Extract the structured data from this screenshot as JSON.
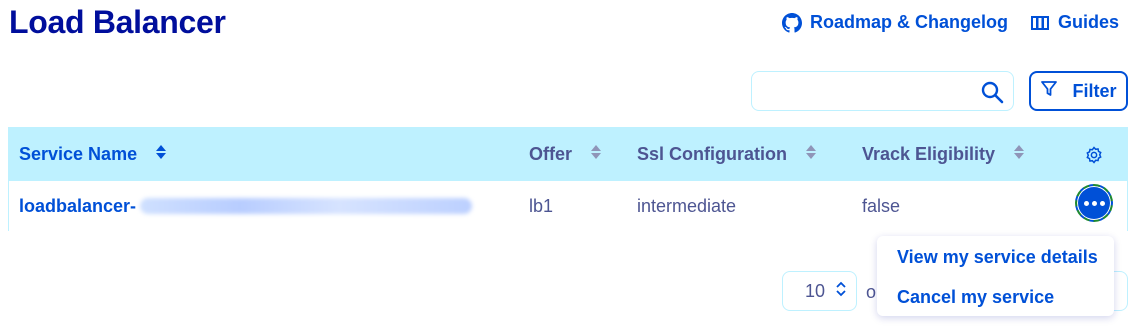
{
  "page": {
    "title": "Load Balancer"
  },
  "header": {
    "roadmap_label": "Roadmap & Changelog",
    "roadmap_icon": "github-icon",
    "guides_label": "Guides",
    "guides_icon": "book-icon"
  },
  "toolbar": {
    "search_value": "",
    "search_icon": "search-icon",
    "filter_label": "Filter",
    "filter_icon": "filter-icon"
  },
  "table": {
    "columns": [
      {
        "label": "Service Name",
        "sortable": true
      },
      {
        "label": "Offer",
        "sortable": true
      },
      {
        "label": "Ssl Configuration",
        "sortable": true
      },
      {
        "label": "Vrack Eligibility",
        "sortable": true
      }
    ],
    "settings_icon": "gear-icon",
    "rows": [
      {
        "service_name": "loadbalancer-",
        "offer": "lb1",
        "ssl_configuration": "intermediate",
        "vrack_eligibility": "false"
      }
    ]
  },
  "action_menu": {
    "items": [
      {
        "label": "View my service details"
      },
      {
        "label": "Cancel my service"
      }
    ]
  },
  "pagination": {
    "page_size": "10",
    "of_text": "o"
  },
  "colors": {
    "primary": "#0050d7",
    "title": "#000e9c",
    "header_bg": "#bef1ff",
    "text": "#4d5592",
    "focus_ring": "#1f8a2e"
  }
}
